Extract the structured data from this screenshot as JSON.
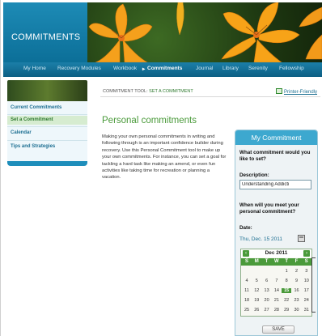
{
  "brand": {
    "title": "COMMITMENTS"
  },
  "nav": {
    "items": [
      "My Home",
      "Recovery Modules",
      "Workbook",
      "Commitments",
      "Journal",
      "Library",
      "Serenity",
      "Fellowship"
    ],
    "active_marker": "▸"
  },
  "sidebar": {
    "items": [
      "Current Commitments",
      "Set a Commitment",
      "Calendar",
      "Tips and Strategies"
    ]
  },
  "breadcrumb": {
    "section": "COMMITMENT TOOL:",
    "current": "SET A COMMITMENT",
    "printer": "Printer-Friendly"
  },
  "main": {
    "title": "Personal commitments",
    "body": "Making your own personal commitments in writing and following through is an important confidence builder during recovery. Use this Personal Commitment tool to make up your own commitments. For instance, you can set a goal for tackling a hard task like making an amend, or even fun activities like taking time for recreation or planning a vacation."
  },
  "panel": {
    "title": "My Commitment",
    "question1": "What commitment would you like to set?",
    "description_label": "Description:",
    "description_value": "Understanding Addicti",
    "question2": "When will you meet your personal commitment?",
    "date_label": "Date:",
    "date_value": "Thu, Dec. 15 2011",
    "save_label": "SAVE"
  },
  "calendar": {
    "title": "Dec 2011",
    "prev": "‹",
    "next": "›",
    "dow": [
      "S",
      "M",
      "T",
      "W",
      "T",
      "F",
      "S"
    ],
    "weeks": [
      [
        "",
        "",
        "",
        "",
        "1",
        "2",
        "3"
      ],
      [
        "4",
        "5",
        "6",
        "7",
        "8",
        "9",
        "10"
      ],
      [
        "11",
        "12",
        "13",
        "14",
        "15",
        "16",
        "17"
      ],
      [
        "18",
        "19",
        "20",
        "21",
        "22",
        "23",
        "24"
      ],
      [
        "25",
        "26",
        "27",
        "28",
        "29",
        "30",
        "31"
      ]
    ],
    "selected": "15"
  },
  "colors": {
    "accent_blue": "#1e8ebb",
    "accent_green": "#4a9a3a"
  }
}
